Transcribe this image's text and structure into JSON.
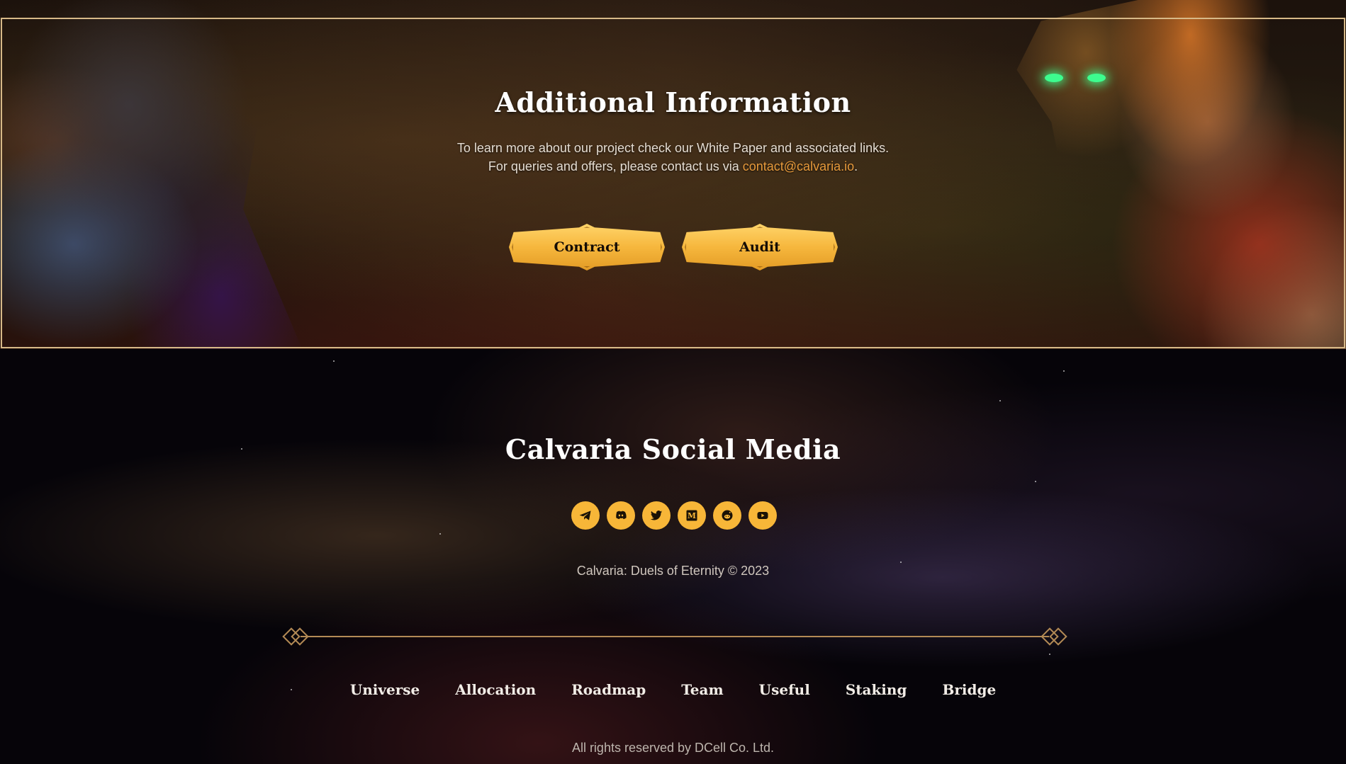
{
  "info": {
    "title": "Additional Information",
    "line1": "To learn more about our project check our White Paper and associated links.",
    "line2_prefix": "For queries and offers, please contact us via ",
    "email": "contact@calvaria.io",
    "line2_suffix": ".",
    "buttons": {
      "contract": "Contract",
      "audit": "Audit"
    }
  },
  "social": {
    "title": "Calvaria Social Media",
    "icons": [
      "telegram-icon",
      "discord-icon",
      "twitter-icon",
      "medium-icon",
      "reddit-icon",
      "youtube-icon"
    ],
    "medium_letter": "M"
  },
  "copyright": "Calvaria: Duels of Eternity © 2023",
  "footer_nav": [
    "Universe",
    "Allocation",
    "Roadmap",
    "Team",
    "Useful",
    "Staking",
    "Bridge"
  ],
  "rights": "All rights reserved by DCell Co. Ltd.",
  "colors": {
    "gold": "#f7b638",
    "frame": "#d7b988",
    "email": "#e79a3b",
    "divider": "#b38a55"
  }
}
